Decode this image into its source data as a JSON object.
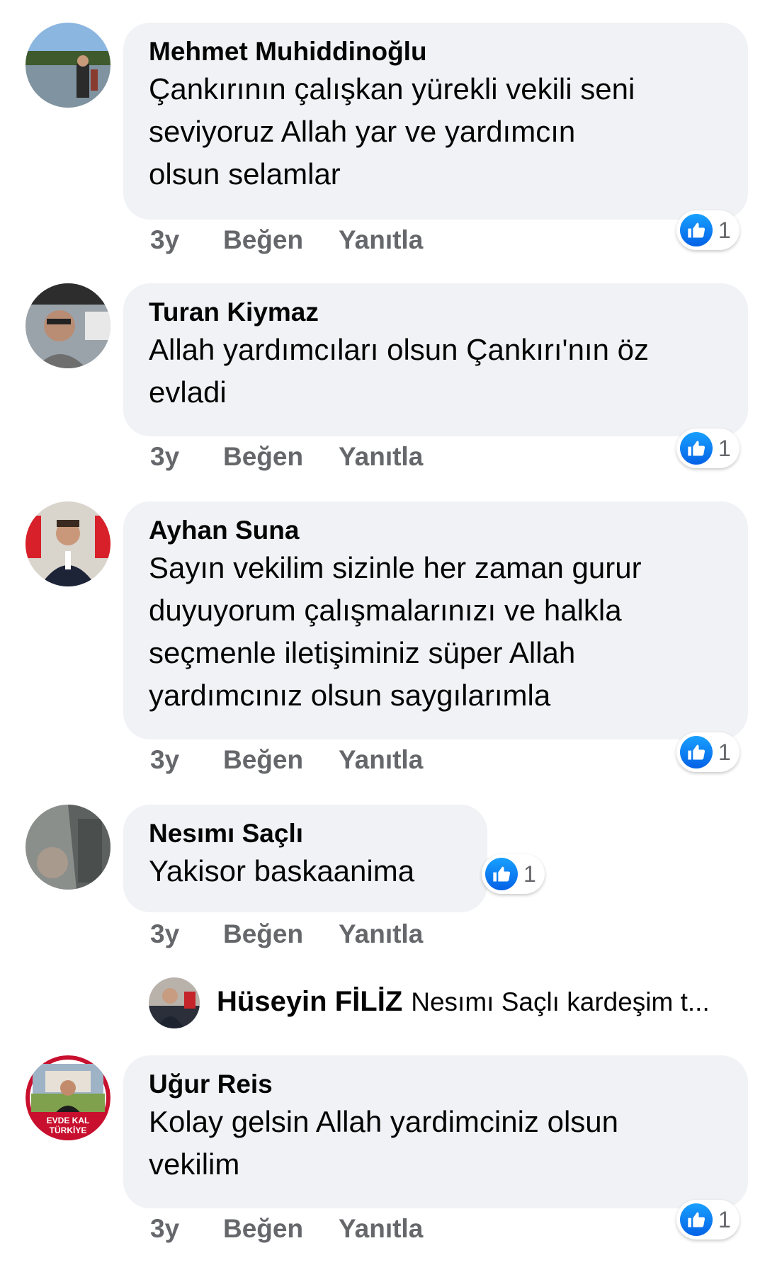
{
  "comments": [
    {
      "author": "Mehmet Muhiddinoğlu",
      "text_lines": [
        "Çankırının çalışkan yürekli vekili seni",
        "seviyoruz Allah yar ve yardımcın",
        "olsun selamlar"
      ],
      "time": "3y",
      "like_label": "Beğen",
      "reply_label": "Yanıtla",
      "reaction_count": "1"
    },
    {
      "author": "Turan Kiymaz",
      "text_lines": [
        "Allah yardımcıları olsun Çankırı'nın öz",
        "evladi"
      ],
      "time": "3y",
      "like_label": "Beğen",
      "reply_label": "Yanıtla",
      "reaction_count": "1"
    },
    {
      "author": "Ayhan Suna",
      "text_lines": [
        "Sayın vekilim sizinle her zaman gurur",
        "duyuyorum çalışmalarınızı ve halkla",
        "seçmenle iletişiminiz süper Allah",
        "yardımcınız olsun saygılarımla"
      ],
      "time": "3y",
      "like_label": "Beğen",
      "reply_label": "Yanıtla",
      "reaction_count": "1"
    },
    {
      "author": "Nesımı Saçlı",
      "text_lines": [
        "Yakisor baskaanima"
      ],
      "time": "3y",
      "like_label": "Beğen",
      "reply_label": "Yanıtla",
      "reaction_count": "1"
    },
    {
      "author": "Uğur Reis",
      "text_lines": [
        "Kolay gelsin Allah yardimciniz olsun",
        "vekilim"
      ],
      "time": "3y",
      "like_label": "Beğen",
      "reply_label": "Yanıtla",
      "reaction_count": "1",
      "avatar_text": [
        "EVDE KAL",
        "TÜRKİYE"
      ]
    }
  ],
  "reply_preview": {
    "author": "Hüseyin FİLİZ",
    "snippet": "Nesımı Saçlı kardeşim t..."
  },
  "icons": {
    "reaction": "thumbs-up-icon"
  },
  "colors": {
    "bubble": "#f0f2f5",
    "meta_text": "#65676b",
    "like_blue": "#1877f2"
  }
}
